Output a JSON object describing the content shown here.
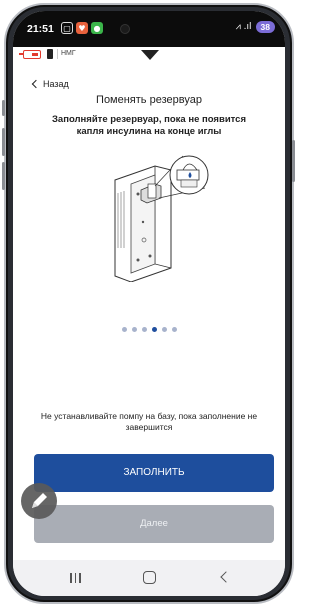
{
  "status_bar": {
    "time": "21:51",
    "battery": "38"
  },
  "app_bar": {
    "cgm_label": "НМГ"
  },
  "header": {
    "back_label": "Назад",
    "title": "Поменять резервуар"
  },
  "instruction": "Заполняйте резервуар, пока не появится капля инсулина на конце иглы",
  "pager": {
    "count": 6,
    "active_index": 3
  },
  "warning": "Не устанавливайте помпу на базу, пока заполнение не завершится",
  "buttons": {
    "fill_label": "ЗАПОЛНИТЬ",
    "next_label": "Далее"
  },
  "colors": {
    "primary": "#1e4e9d",
    "disabled": "#a9adb5",
    "dot_active": "#1f4e9e",
    "dot_inactive": "#a8b3cc",
    "pump_icon": "#e23b2f",
    "battery_pill": "#7b6cd6"
  },
  "icons": [
    "back-chevron-icon",
    "pump-icon",
    "edit-pencil-icon",
    "recent-apps-icon",
    "home-icon",
    "back-icon"
  ]
}
